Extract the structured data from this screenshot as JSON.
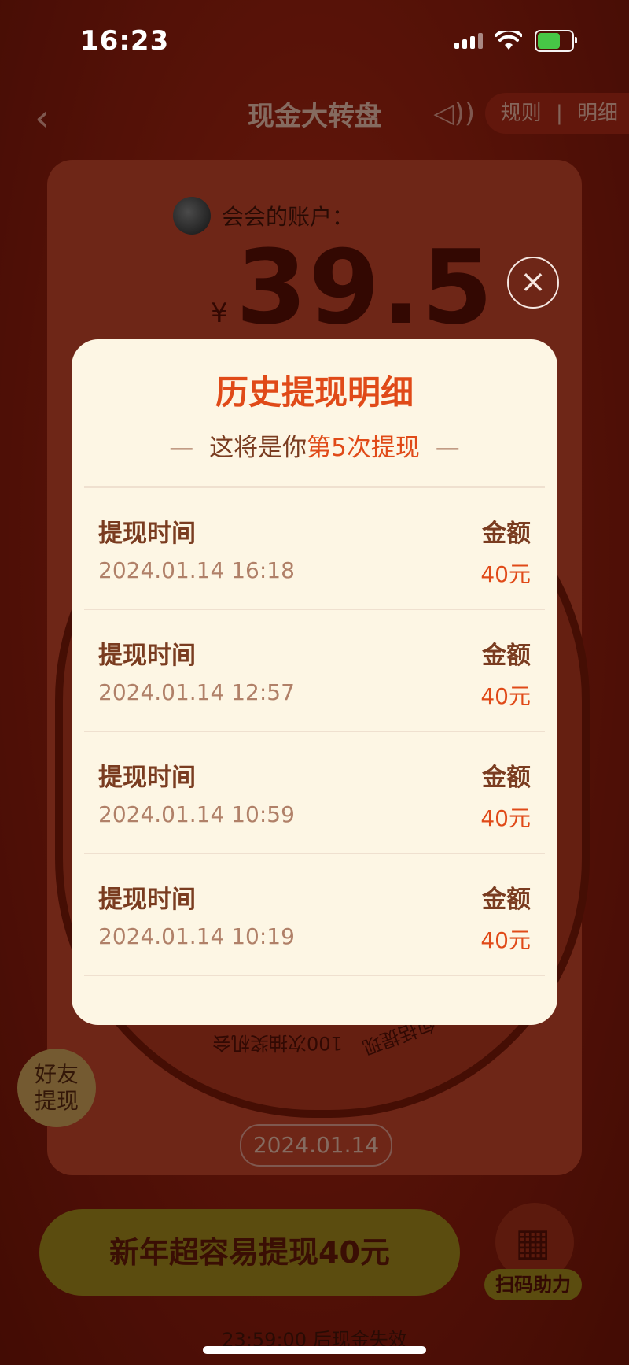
{
  "status_bar": {
    "time": "16:23"
  },
  "nav": {
    "title": "现金大转盘",
    "rules_label": "规则",
    "separator": "|",
    "detail_label": "明细"
  },
  "account": {
    "label": "会会的账户：",
    "currency": "¥",
    "balance": "39.5"
  },
  "wheel": {
    "text_1": "100次抽奖机会",
    "text_2": "包括提现"
  },
  "friend_withdraw": {
    "line1": "好友",
    "line2": "提现"
  },
  "date_pill": "2024.01.14",
  "cta": {
    "label": "新年超容易提现40元"
  },
  "scan": {
    "label": "扫码助力"
  },
  "expire_text": "23:59:00 后现金失效",
  "modal": {
    "title": "历史提现明细",
    "subtitle_prefix": "这将是你",
    "subtitle_highlight": "第5次提现",
    "dash": "—",
    "rows": [
      {
        "label": "提现时间",
        "time": "2024.01.14 16:18",
        "amount_label": "金额",
        "amount": "40元"
      },
      {
        "label": "提现时间",
        "time": "2024.01.14 12:57",
        "amount_label": "金额",
        "amount": "40元"
      },
      {
        "label": "提现时间",
        "time": "2024.01.14 10:59",
        "amount_label": "金额",
        "amount": "40元"
      },
      {
        "label": "提现时间",
        "time": "2024.01.14 10:19",
        "amount_label": "金额",
        "amount": "40元"
      }
    ]
  },
  "colors": {
    "accent": "#e04a18",
    "modal_bg": "#fdf6e4",
    "text_brown": "#7a3c20",
    "text_muted": "#b08068"
  }
}
